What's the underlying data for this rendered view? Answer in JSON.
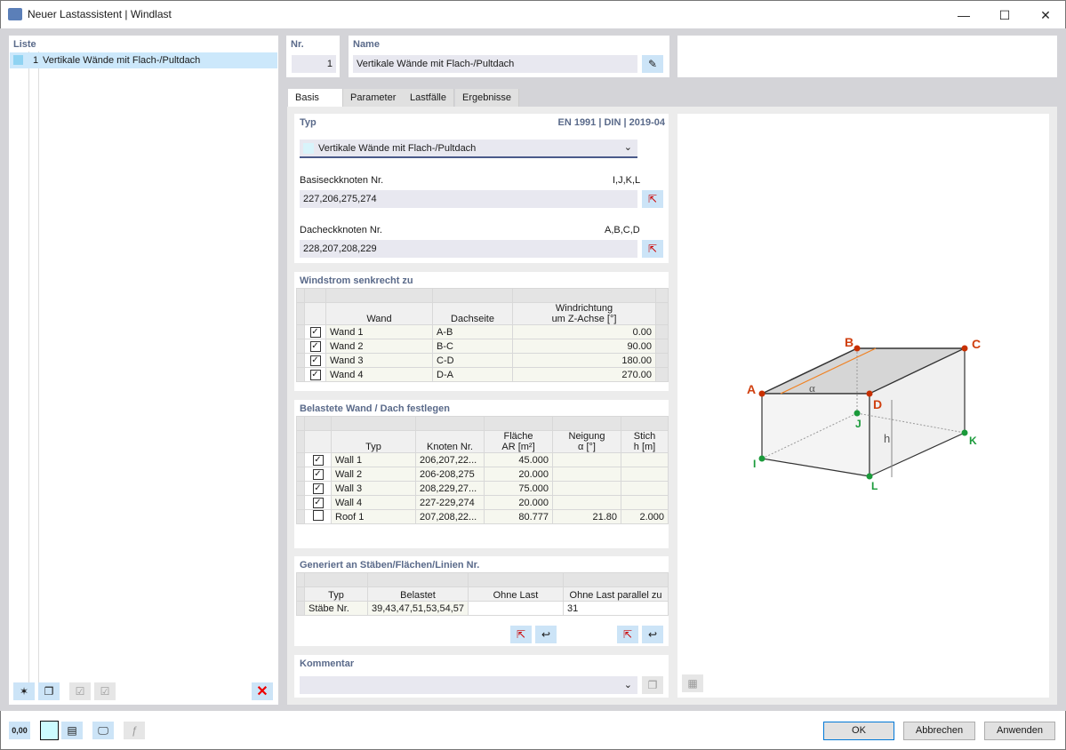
{
  "window": {
    "title": "Neuer Lastassistent | Windlast"
  },
  "list": {
    "header": "Liste",
    "items": [
      {
        "nr": "1",
        "label": "Vertikale Wände mit Flach-/Pultdach",
        "color": "#8fd3f2"
      }
    ]
  },
  "nr": {
    "label": "Nr.",
    "value": "1"
  },
  "name": {
    "label": "Name",
    "value": "Vertikale Wände mit Flach-/Pultdach"
  },
  "tabs": [
    {
      "label": "Basis",
      "active": true
    },
    {
      "label": "Parameter"
    },
    {
      "label": "Lastfälle"
    },
    {
      "label": "Ergebnisse"
    }
  ],
  "typ": {
    "header": "Typ",
    "norm": "EN 1991 | DIN | 2019-04",
    "selected": "Vertikale Wände mit Flach-/Pultdach",
    "base_label": "Basiseckknoten Nr.",
    "base_hint": "I,J,K,L",
    "base_value": "227,206,275,274",
    "roof_label": "Dacheckknoten Nr.",
    "roof_hint": "A,B,C,D",
    "roof_value": "228,207,208,229"
  },
  "windstrom": {
    "header": "Windstrom senkrecht zu",
    "columns": [
      "Wand",
      "Dachseite",
      "Windrichtung",
      "um Z-Achse [°]"
    ],
    "rows": [
      {
        "checked": true,
        "wand": "Wand 1",
        "seite": "A-B",
        "dir": "0.00"
      },
      {
        "checked": true,
        "wand": "Wand 2",
        "seite": "B-C",
        "dir": "90.00"
      },
      {
        "checked": true,
        "wand": "Wand 3",
        "seite": "C-D",
        "dir": "180.00"
      },
      {
        "checked": true,
        "wand": "Wand 4",
        "seite": "D-A",
        "dir": "270.00"
      }
    ]
  },
  "belastet": {
    "header": "Belastete Wand / Dach festlegen",
    "columns": {
      "typ": "Typ",
      "knoten": "Knoten Nr.",
      "flaeche1": "Fläche",
      "flaeche2": "AR [m²]",
      "neigung1": "Neigung",
      "neigung2": "α [°]",
      "stich1": "Stich",
      "stich2": "h [m]"
    },
    "rows": [
      {
        "checked": true,
        "typ": "Wall 1",
        "knoten": "206,207,22...",
        "a": "45.000",
        "alpha": "",
        "h": ""
      },
      {
        "checked": true,
        "typ": "Wall 2",
        "knoten": "206-208,275",
        "a": "20.000",
        "alpha": "",
        "h": ""
      },
      {
        "checked": true,
        "typ": "Wall 3",
        "knoten": "208,229,27...",
        "a": "75.000",
        "alpha": "",
        "h": ""
      },
      {
        "checked": true,
        "typ": "Wall 4",
        "knoten": "227-229,274",
        "a": "20.000",
        "alpha": "",
        "h": ""
      },
      {
        "checked": false,
        "typ": "Roof 1",
        "knoten": "207,208,22...",
        "a": "80.777",
        "alpha": "21.80",
        "h": "2.000"
      }
    ]
  },
  "generiert": {
    "header": "Generiert an Stäben/Flächen/Linien Nr.",
    "columns": [
      "Typ",
      "Belastet",
      "Ohne Last",
      "Ohne Last parallel zu"
    ],
    "row": {
      "typ": "Stäbe Nr.",
      "belastet": "39,43,47,51,53,54,57",
      "ohne": "",
      "parallel": "31"
    }
  },
  "kommentar": {
    "header": "Kommentar",
    "value": ""
  },
  "diagram": {
    "labels": {
      "A": "A",
      "B": "B",
      "C": "C",
      "D": "D",
      "I": "I",
      "J": "J",
      "K": "K",
      "L": "L",
      "h": "h",
      "alpha": "α"
    }
  },
  "buttons": {
    "ok": "OK",
    "cancel": "Abbrechen",
    "apply": "Anwenden"
  },
  "statusbar": {
    "units": "0,00"
  }
}
